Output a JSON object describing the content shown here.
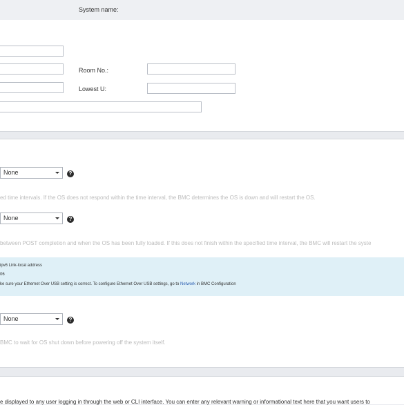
{
  "header": {
    "system_name_label": "System name:"
  },
  "location": {
    "room_label": "Room No.:",
    "lowest_u_label": "Lowest U:"
  },
  "watchdog1": {
    "selected": "None",
    "help_glyph": "?",
    "description": "ed time intervals. If the OS does not respond within the time interval, the BMC determines the OS is down and will restart the OS."
  },
  "watchdog2": {
    "selected": "None",
    "help_glyph": "?",
    "description": "between POST completion and when the OS has been fully loaded. If this does not finish within the specified time interval, the BMC will restart the syste"
  },
  "info_box": {
    "line1": "ipv6 Link-local address",
    "line2": "06",
    "line3_prefix": "ke sure your Ethernet Over USB setting is correct. To configure Ethernet Over USB settings, go to ",
    "line3_link": "Network",
    "line3_suffix": " in BMC Configuration"
  },
  "watchdog3": {
    "selected": "None",
    "help_glyph": "?",
    "description": "BMC to wait for OS shut down before powering off the system itself."
  },
  "login_message": {
    "description": "e displayed to any user logging in through the web or CLI interface. You can enter any relevant warning or informational text here that you want users to"
  },
  "colors": {
    "info_bg": "#dff0f7",
    "link": "#2a5db0",
    "page_bg": "#e9ebef"
  }
}
